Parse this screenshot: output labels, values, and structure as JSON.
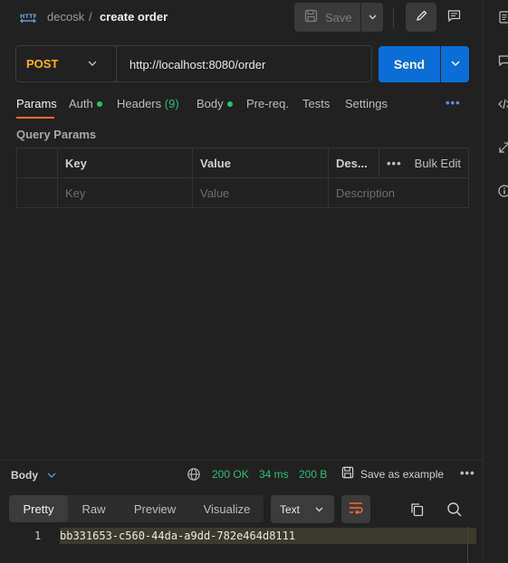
{
  "breadcrumb": {
    "workspace": "decosk",
    "separator": "/",
    "request_name": "create order"
  },
  "toolbar": {
    "save_label": "Save"
  },
  "request": {
    "method": "POST",
    "url": "http://localhost:8080/order",
    "send_label": "Send"
  },
  "tabs": [
    {
      "label": "Params",
      "active": true
    },
    {
      "label": "Auth",
      "dot": true
    },
    {
      "label": "Headers",
      "count": "(9)"
    },
    {
      "label": "Body",
      "dot": true
    },
    {
      "label": "Pre-req."
    },
    {
      "label": "Tests"
    },
    {
      "label": "Settings"
    }
  ],
  "tabs_more": "•••",
  "query_params": {
    "label": "Query Params",
    "headers": [
      "Key",
      "Value",
      "Des...",
      "Bulk Edit"
    ],
    "more": "•••",
    "placeholders": [
      "Key",
      "Value",
      "Description"
    ]
  },
  "response": {
    "body_label": "Body",
    "status": "200 OK",
    "time": "34 ms",
    "size": "200 B",
    "save_example": "Save as example",
    "more": "•••",
    "views": [
      "Pretty",
      "Raw",
      "Preview",
      "Visualize"
    ],
    "format": "Text",
    "line_number": "1",
    "body_text": "bb331653-c560-44da-a9dd-782e464d8111"
  },
  "colors": {
    "accent_orange": "#ff6c37",
    "method_post": "#ffb400",
    "send_blue": "#0b6ed6",
    "status_green": "#2fbf71"
  },
  "icons": [
    "http-icon",
    "floppy-icon",
    "chevron-down-icon",
    "pencil-icon",
    "comment-icon",
    "globe-icon",
    "wrap-lines-icon",
    "copy-icon",
    "search-icon",
    "docs-icon",
    "code-icon",
    "related-icon",
    "info-icon"
  ]
}
